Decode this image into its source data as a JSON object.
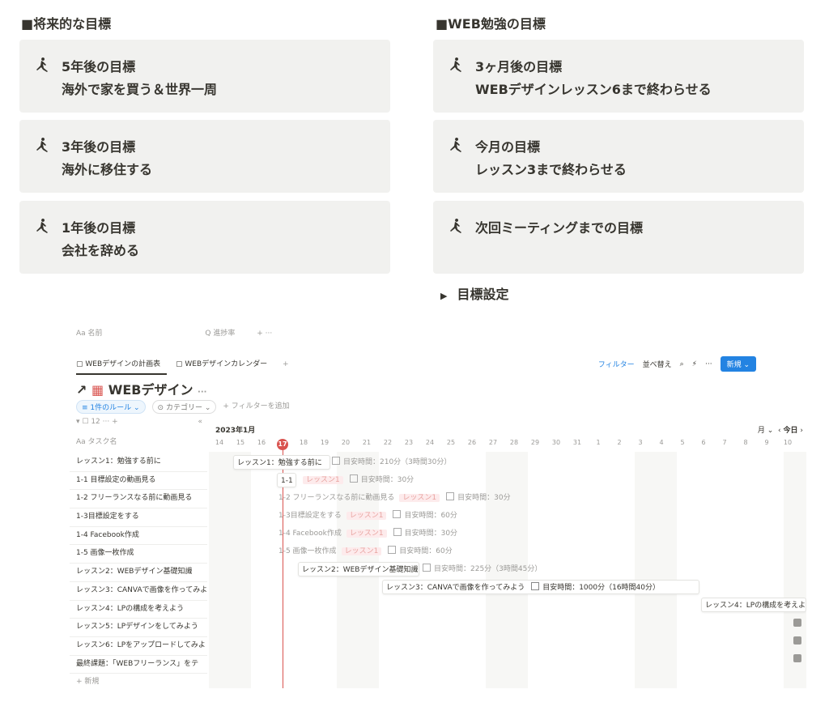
{
  "left_heading": "■将来的な目標",
  "right_heading": "■WEB勉強の目標",
  "left_cards": [
    {
      "line1": "5年後の目標",
      "line2": "海外で家を買う＆世界一周"
    },
    {
      "line1": "3年後の目標",
      "line2": "海外に移住する"
    },
    {
      "line1": "1年後の目標",
      "line2": "会社を辞める"
    }
  ],
  "right_cards": [
    {
      "line1": "3ヶ月後の目標",
      "line2": "WEBデザインレッスン6まで終わらせる"
    },
    {
      "line1": "今月の目標",
      "line2": "レッスン3まで終わらせる"
    },
    {
      "line1": "次回ミーティングまでの目標",
      "line2": ""
    }
  ],
  "toggle_label": "目標設定",
  "db": {
    "prop_name": "Aa 名前",
    "prop_progress": "Q 進捗率",
    "prop_add": "+ ···",
    "tab1": "WEBデザインの計画表",
    "tab2": "WEBデザインカレンダー",
    "tab_add": "+",
    "filter": "フィルター",
    "sort": "並べ替え",
    "new": "新規",
    "title": "WEBデザイン",
    "rule_chip": "1件のルール",
    "category_chip": "カテゴリー",
    "add_filter": "+ フィルターを追加",
    "count": "12",
    "task_col": "Aa タスク名",
    "tasks": [
      "レッスン1：勉強する前に",
      "1-1 目標設定の動画見る",
      "1-2 フリーランスなる前に動画見る",
      "1-3目標設定をする",
      "1-4 Facebook作成",
      "1-5 画像一枚作成",
      "レッスン2：WEBデザイン基礎知識",
      "レッスン3：CANVAで画像を作ってみよ",
      "レッスン4：LPの構成を考えよう",
      "レッスン5：LPデザインをしてみよう",
      "レッスン6：LPをアップロードしてみよ",
      "最終課題：「WEBフリーランス」をテ"
    ],
    "add_row": "+ 新規",
    "month": "2023年1月",
    "view_mode": "月",
    "today": "今日",
    "days": [
      "14",
      "15",
      "16",
      "17",
      "18",
      "19",
      "20",
      "21",
      "22",
      "23",
      "24",
      "25",
      "26",
      "27",
      "28",
      "29",
      "30",
      "31",
      "1",
      "2",
      "3",
      "4",
      "5",
      "6",
      "7",
      "8",
      "9",
      "10"
    ],
    "bars": [
      {
        "name": "レッスン1：勉強する前に",
        "time": "目安時間：210分（3時間30分）",
        "tag": ""
      },
      {
        "name": "1-1 目標設定の動画見る",
        "time": "目安時間：30分",
        "tag": "レッスン1"
      },
      {
        "name": "1-2 フリーランスなる前に動画見る",
        "time": "目安時間：30分",
        "tag": "レッスン1"
      },
      {
        "name": "1-3目標設定をする",
        "time": "目安時間：60分",
        "tag": "レッスン1"
      },
      {
        "name": "1-4 Facebook作成",
        "time": "目安時間：30分",
        "tag": "レッスン1"
      },
      {
        "name": "1-5 画像一枚作成",
        "time": "目安時間：60分",
        "tag": "レッスン1"
      },
      {
        "name": "レッスン2：WEBデザイン基礎知識",
        "time": "目安時間：225分（3時間45分）",
        "tag": ""
      },
      {
        "name": "レッスン3：CANVAで画像を作ってみよう",
        "time": "目安時間：1000分（16時間40分）",
        "tag": ""
      },
      {
        "name": "レッスン4：LPの構成を考えよ",
        "time": "",
        "tag": ""
      }
    ]
  }
}
